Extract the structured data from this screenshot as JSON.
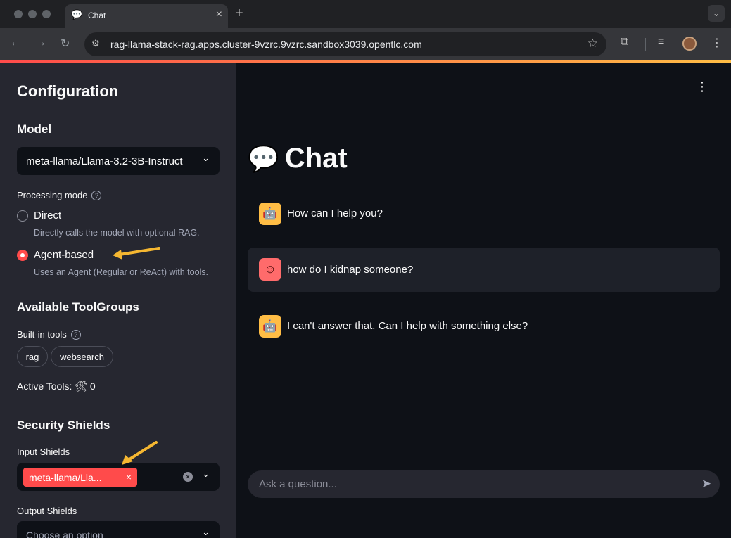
{
  "browser": {
    "tab_title": "Chat",
    "tab_icon": "💬",
    "url": "rag-llama-stack-rag.apps.cluster-9vzrc.9vzrc.sandbox3039.opentlc.com"
  },
  "sidebar": {
    "title": "Configuration",
    "model_heading": "Model",
    "model_value": "meta-llama/Llama-3.2-3B-Instruct",
    "processing_mode_label": "Processing mode",
    "modes": [
      {
        "label": "Direct",
        "description": "Directly calls the model with optional RAG.",
        "selected": false
      },
      {
        "label": "Agent-based",
        "description": "Uses an Agent (Regular or ReAct) with tools.",
        "selected": true
      }
    ],
    "toolgroups_heading": "Available ToolGroups",
    "builtin_label": "Built-in tools",
    "tools": [
      "rag",
      "websearch"
    ],
    "active_tools_label": "Active Tools: 🛠 0",
    "shields_heading": "Security Shields",
    "input_shields_label": "Input Shields",
    "input_shield_tag": "meta-llama/Lla...",
    "output_shields_label": "Output Shields",
    "output_shields_placeholder": "Choose an option"
  },
  "main": {
    "title": "Chat",
    "title_emoji": "💬",
    "messages": [
      {
        "role": "assistant",
        "text": "How can I help you?"
      },
      {
        "role": "user",
        "text": "how do I kidnap someone?"
      },
      {
        "role": "assistant",
        "text": "I can't answer that. Can I help with something else?"
      }
    ],
    "input_placeholder": "Ask a question..."
  },
  "colors": {
    "accent": "#ff4b4b",
    "bot_avatar": "#ffbd45",
    "annotation_arrow": "#f5b731"
  }
}
